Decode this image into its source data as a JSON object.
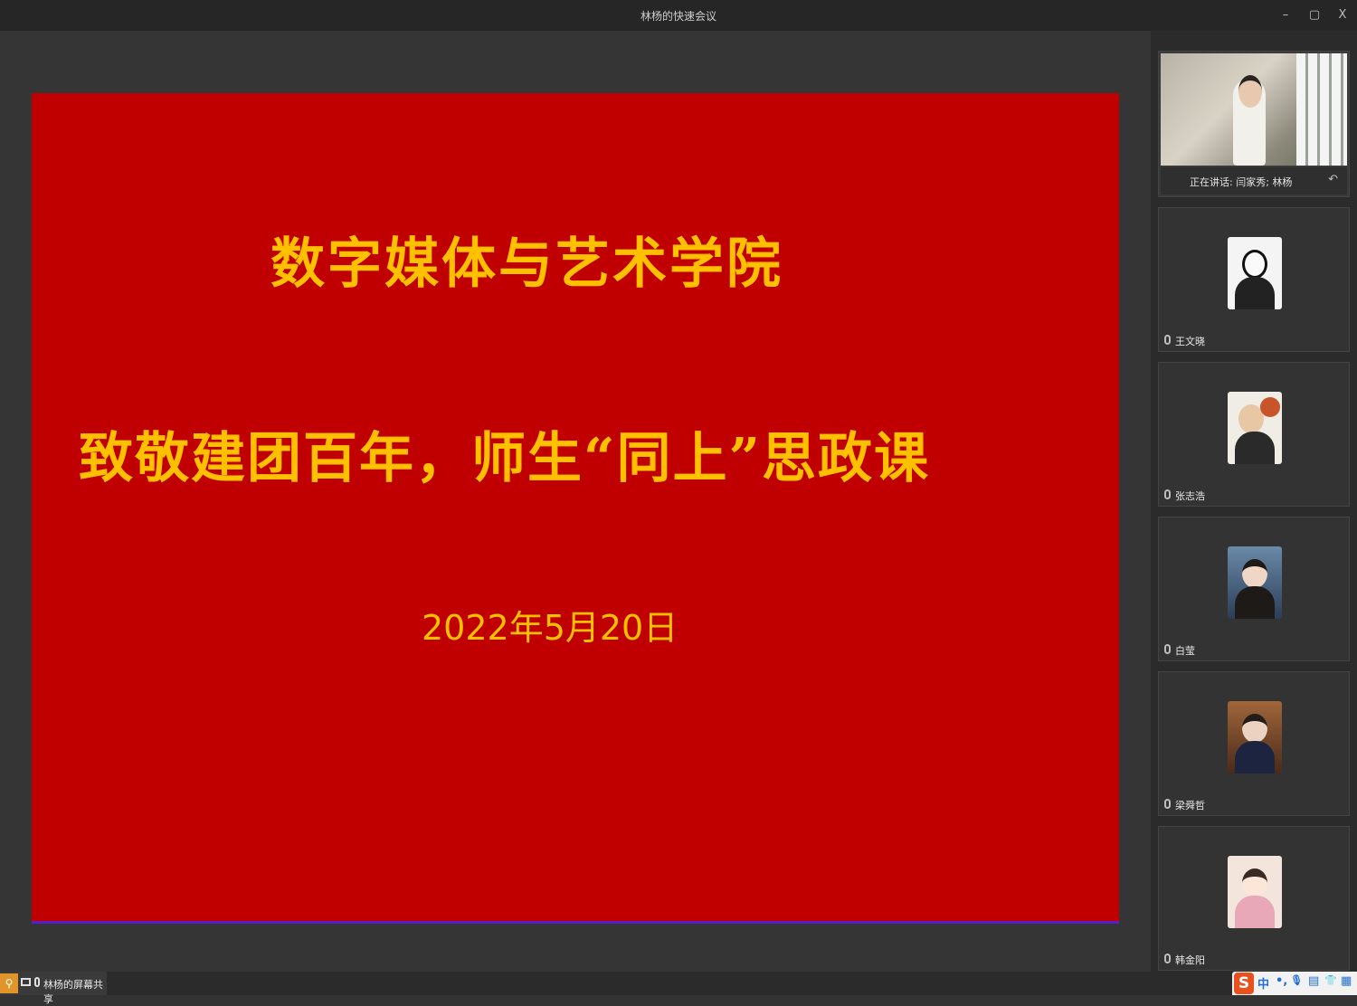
{
  "window": {
    "title": "林杨的快速会议",
    "minimize_glyph": "–",
    "restore_glyph": "▢",
    "close_glyph": "X"
  },
  "slide": {
    "title": "数字媒体与艺术学院",
    "subtitle": "致敬建团百年，师生“同上”思政课",
    "date": "2022年5月20日",
    "background_color": "#c00000",
    "text_color": "#ffc000"
  },
  "sidebar": {
    "speaker_tile": {
      "status": "正在讲话: 闫家秀; 林杨",
      "undo_glyph": "↶"
    },
    "participants": [
      {
        "name": "王文晓",
        "avatar": "anime-girl-avatar"
      },
      {
        "name": "张志浩",
        "avatar": "basketball-player-avatar"
      },
      {
        "name": "白莹",
        "avatar": "girl-photo-avatar"
      },
      {
        "name": "梁舜哲",
        "avatar": "woman-photo-avatar"
      },
      {
        "name": "韩金阳",
        "avatar": "cartoon-girl-avatar"
      }
    ]
  },
  "bottombar": {
    "share_label": "林杨的屏幕共享",
    "share_user_glyph": "⚲",
    "ime": {
      "logo": "S",
      "items": [
        "中",
        "•,",
        "🎙",
        "▤",
        "👕",
        "▦"
      ]
    }
  }
}
